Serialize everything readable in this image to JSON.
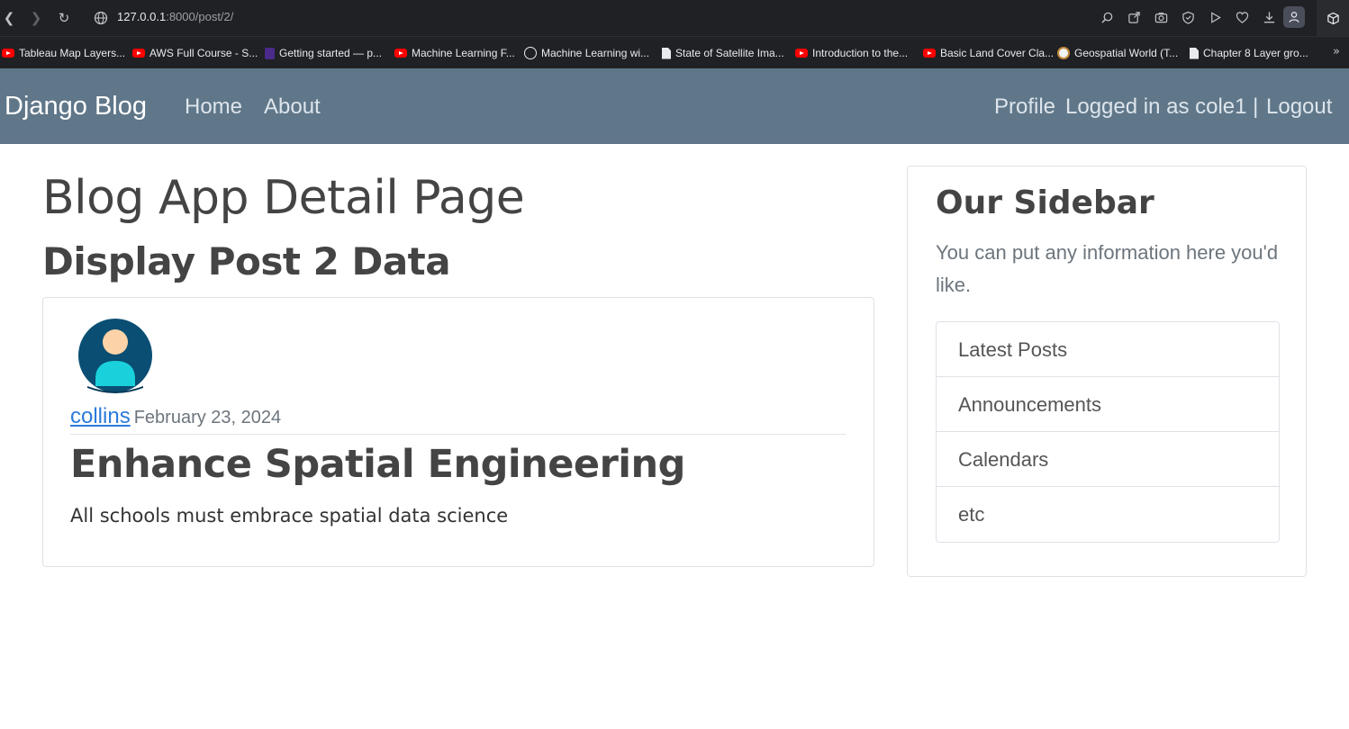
{
  "browser": {
    "url_host": "127.0.0.1",
    "url_path": ":8000/post/2/",
    "bookmarks": [
      {
        "label": "Tableau Map Layers...",
        "icon": "youtube-icon"
      },
      {
        "label": "AWS Full Course - S...",
        "icon": "youtube-icon"
      },
      {
        "label": "Getting started — p...",
        "icon": "site-icon"
      },
      {
        "label": "Machine Learning F...",
        "icon": "youtube-icon"
      },
      {
        "label": "Machine Learning wi...",
        "icon": "site-icon"
      },
      {
        "label": "State of Satellite Ima...",
        "icon": "document-icon"
      },
      {
        "label": "Introduction to the...",
        "icon": "youtube-icon"
      },
      {
        "label": "Basic Land Cover Cla...",
        "icon": "youtube-icon"
      },
      {
        "label": "Geospatial World (T...",
        "icon": "site-icon"
      },
      {
        "label": "Chapter 8 Layer gro...",
        "icon": "document-icon"
      }
    ]
  },
  "navbar": {
    "brand": "Django Blog",
    "home": "Home",
    "about": "About",
    "profile": "Profile",
    "logged_in": "Logged in as cole1 |",
    "logout": "Logout",
    "color": "#607789"
  },
  "main": {
    "title": "Blog App Detail Page",
    "subtitle": "Display Post 2 Data"
  },
  "post": {
    "author": "collins",
    "date": "February 23, 2024",
    "title": "Enhance Spatial Engineering",
    "content": "All schools must embrace spatial data science"
  },
  "sidebar": {
    "title": "Our Sidebar",
    "text": "You can put any information here you'd like.",
    "items": [
      "Latest Posts",
      "Announcements",
      "Calendars",
      "etc"
    ]
  }
}
